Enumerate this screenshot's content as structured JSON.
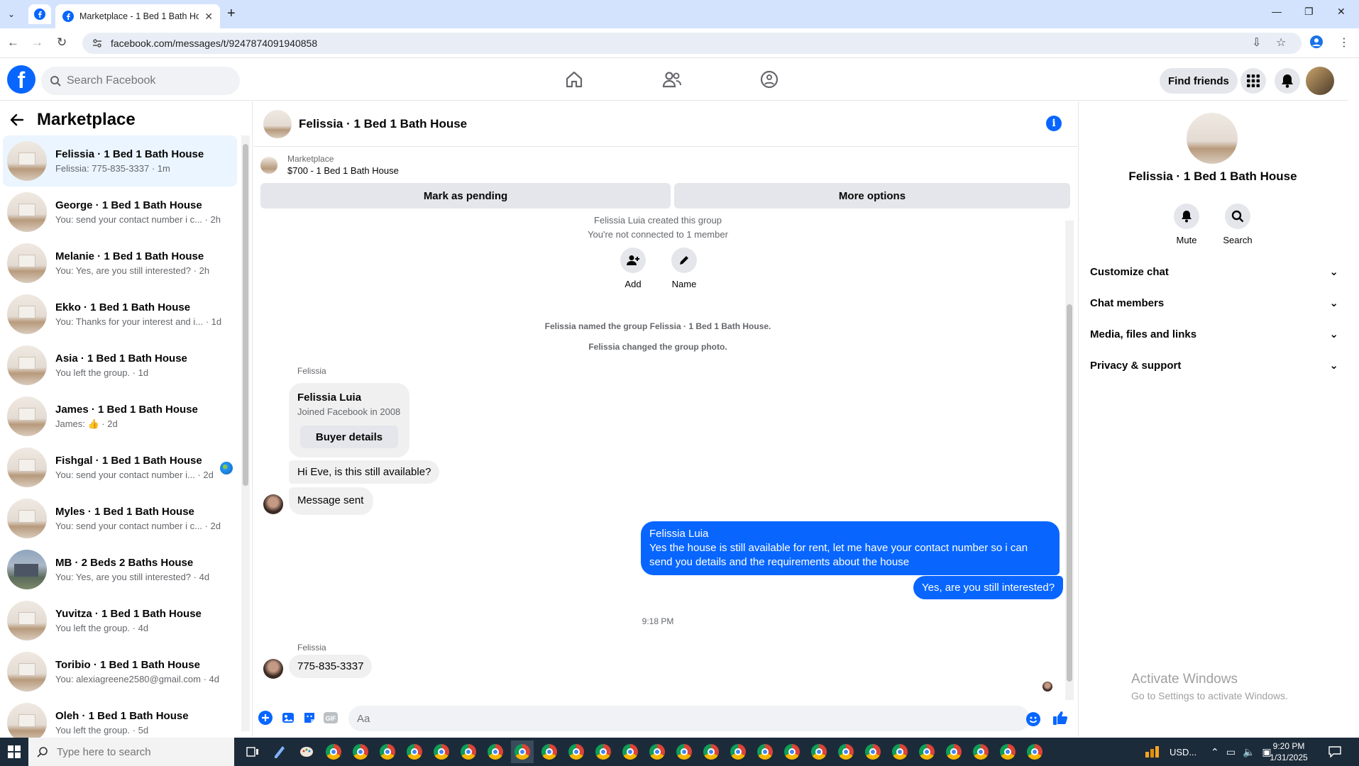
{
  "browser": {
    "tab_title": "Marketplace - 1 Bed 1 Bath Hou",
    "url": "facebook.com/messages/t/9247874091940858"
  },
  "fb_header": {
    "search_placeholder": "Search Facebook",
    "find_friends": "Find friends"
  },
  "sidebar": {
    "title": "Marketplace",
    "conversations": [
      {
        "name": "Felissia · 1 Bed 1 Bath House",
        "snippet": "Felissia: 775-835-3337 · 1m"
      },
      {
        "name": "George · 1 Bed 1 Bath House",
        "snippet": "You: send your contact number i c... · 2h"
      },
      {
        "name": "Melanie · 1 Bed 1 Bath House",
        "snippet": "You: Yes, are you still interested? · 2h"
      },
      {
        "name": "Ekko · 1 Bed 1 Bath House",
        "snippet": "You: Thanks for your interest and i... · 1d"
      },
      {
        "name": "Asia · 1 Bed 1 Bath House",
        "snippet": "You left the group. · 1d"
      },
      {
        "name": "James · 1 Bed 1 Bath House",
        "snippet": "James: 👍 · 2d"
      },
      {
        "name": "Fishgal · 1 Bed 1 Bath House",
        "snippet": "You: send your contact number i... · 2d"
      },
      {
        "name": "Myles · 1 Bed 1 Bath House",
        "snippet": "You: send your contact number i c... · 2d"
      },
      {
        "name": "MB · 2 Beds 2 Baths House",
        "snippet": "You: Yes, are you still interested? · 4d"
      },
      {
        "name": "Yuvitza · 1 Bed 1 Bath House",
        "snippet": "You left the group. · 4d"
      },
      {
        "name": "Toribio · 1 Bed 1 Bath House",
        "snippet": "You: alexiagreene2580@gmail.com · 4d"
      },
      {
        "name": "Oleh · 1 Bed 1 Bath House",
        "snippet": "You left the group. · 5d"
      }
    ]
  },
  "chat": {
    "title": "Felissia · 1 Bed 1 Bath House",
    "marketplace_label": "Marketplace",
    "listing": "$700 - 1 Bed 1 Bath House",
    "mark_pending": "Mark as pending",
    "more_options": "More options",
    "sys_created": "Felissia Luia created this group",
    "sys_not_connected": "You're not connected to 1 member",
    "add_label": "Add",
    "name_label": "Name",
    "sys_named": "Felissia named the group Felissia · 1 Bed 1 Bath House.",
    "sys_photo": "Felissia changed the group photo.",
    "sender_1": "Felissia",
    "card_name": "Felissia Luia",
    "card_sub": "Joined Facebook in 2008",
    "card_button": "Buyer details",
    "msg_in_1": "Hi Eve, is this still available?",
    "msg_in_2": "Message sent",
    "out_name": "Felissia Luia",
    "msg_out_1": "Yes the house is still available for rent, let me have your contact number so i can send you details and the requirements about the house",
    "msg_out_2": "Yes, are you still interested?",
    "timestamp": "9:18 PM",
    "sender_2": "Felissia",
    "msg_in_3": "775-835-3337",
    "composer_placeholder": "Aa"
  },
  "right_panel": {
    "name": "Felissia · 1 Bed 1 Bath House",
    "mute": "Mute",
    "search": "Search",
    "sections": [
      "Customize chat",
      "Chat members",
      "Media, files and links",
      "Privacy & support"
    ],
    "watermark_title": "Activate Windows",
    "watermark_sub": "Go to Settings to activate Windows."
  },
  "taskbar": {
    "search_placeholder": "Type here to search",
    "currency": "USD...",
    "time": "9:20 PM",
    "date": "1/31/2025"
  }
}
